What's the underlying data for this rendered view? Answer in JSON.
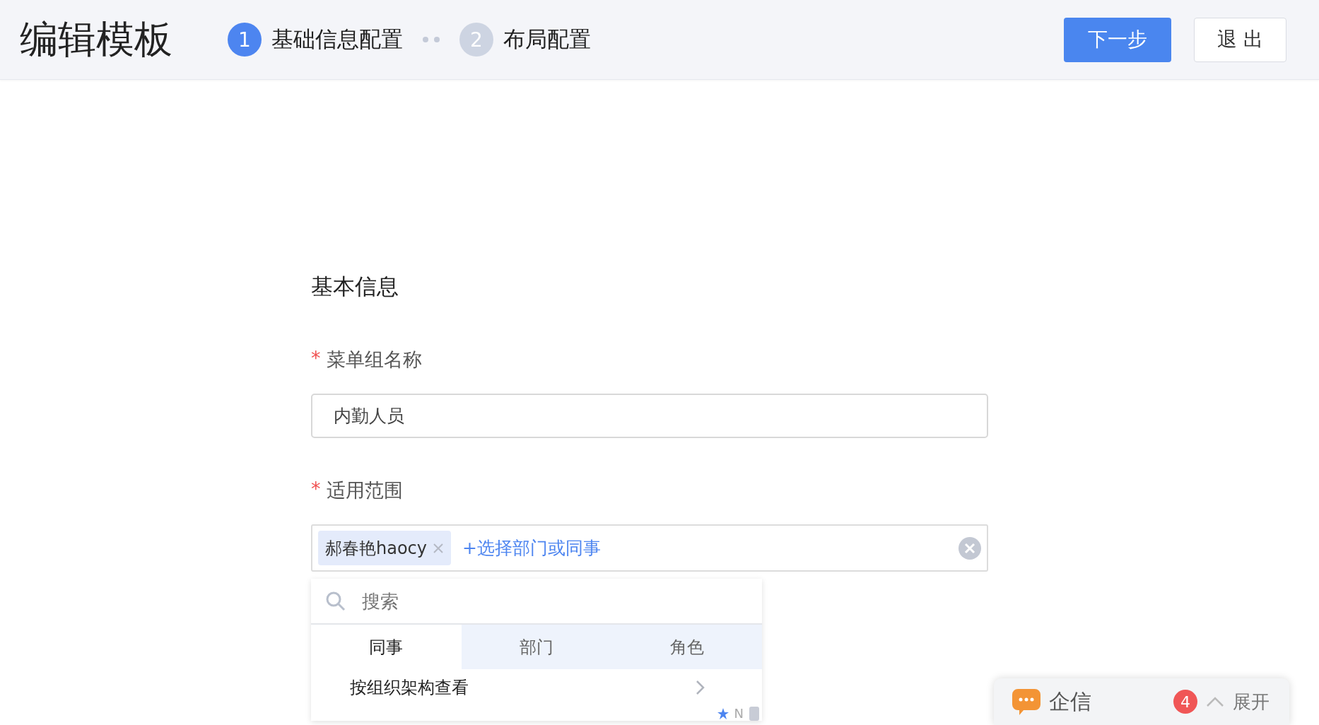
{
  "header": {
    "title": "编辑模板",
    "steps": [
      {
        "number": "1",
        "label": "基础信息配置",
        "selected": true
      },
      {
        "number": "2",
        "label": "布局配置",
        "selected": false
      }
    ],
    "buttons": [
      {
        "label": "下一步",
        "kind": "primary"
      },
      {
        "label": "退 出",
        "kind": "default"
      }
    ]
  },
  "section_title": "基本信息",
  "name_field": {
    "label": "菜单组名称",
    "required_mark": "*",
    "value": "内勤人员"
  },
  "scope_field": {
    "label": "适用范围",
    "required_mark": "*",
    "tags": [
      "郝春艳haocy"
    ],
    "add_link": "+选择部门或同事"
  },
  "picker": {
    "search_placeholder": "搜索",
    "tabs": [
      {
        "label": "同事",
        "selected": true
      },
      {
        "label": "部门",
        "selected": false
      },
      {
        "label": "角色",
        "selected": false
      }
    ],
    "items": [
      "按组织架构查看"
    ],
    "index_letter": "N"
  },
  "chat": {
    "title": "企信",
    "badge": "4",
    "action": "展开"
  }
}
